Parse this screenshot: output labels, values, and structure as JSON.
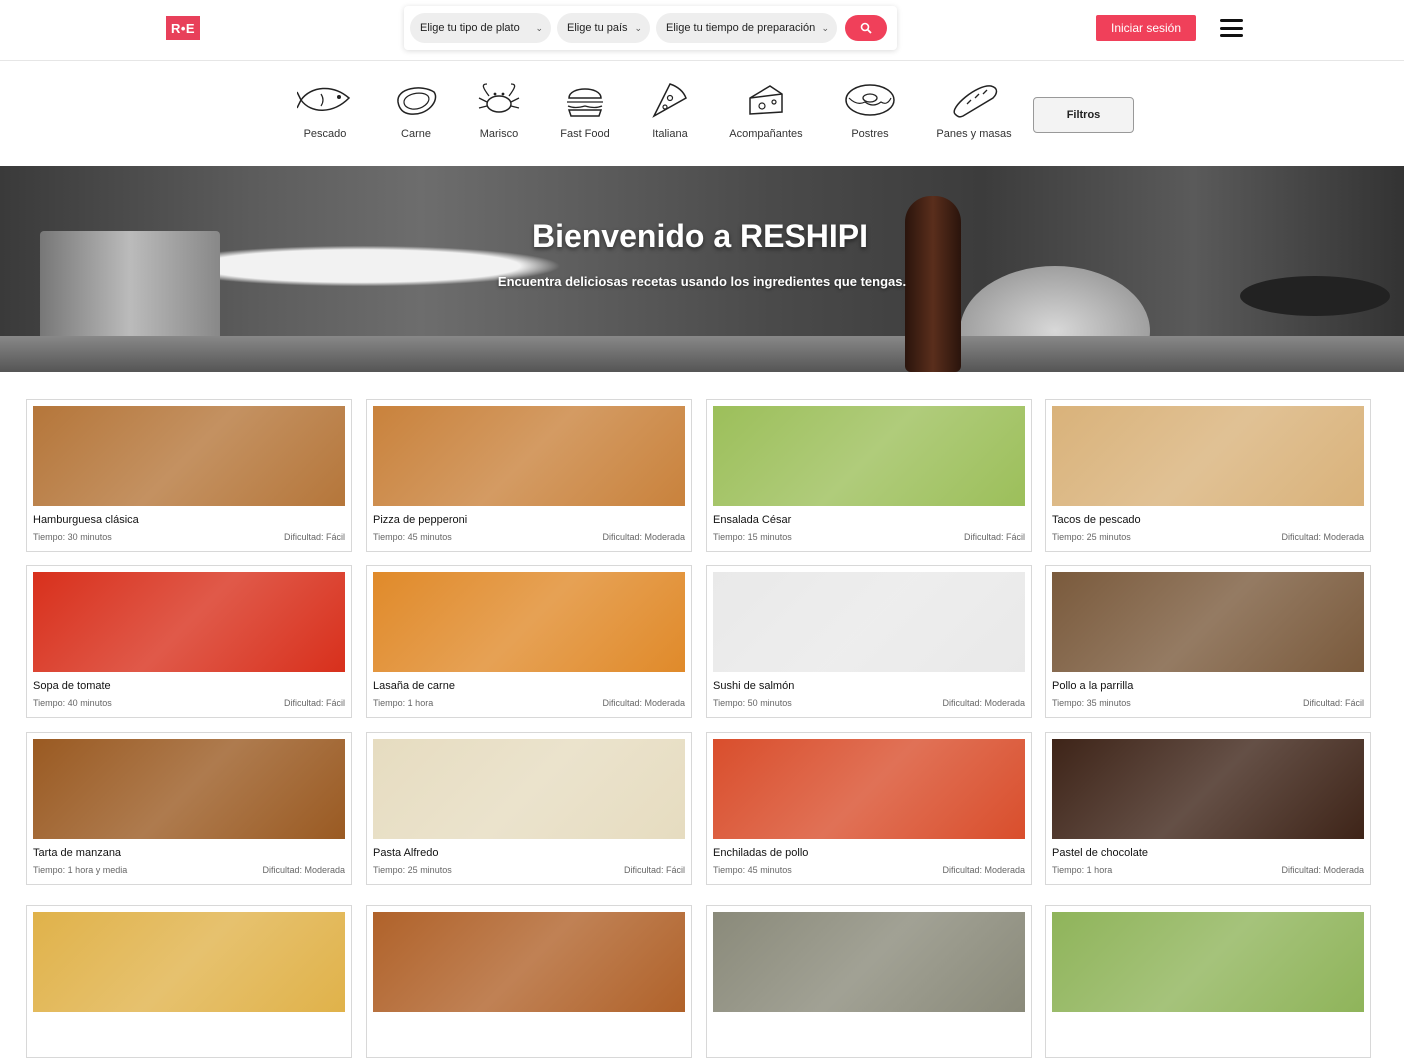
{
  "header": {
    "logo_text": "R•E",
    "filters": [
      {
        "label": "Elige tu tipo de plato"
      },
      {
        "label": "Elige tu país"
      },
      {
        "label": "Elige tu tiempo de preparación"
      }
    ],
    "login_label": "Iniciar sesión",
    "accent_color": "#f0405a"
  },
  "categories": [
    {
      "label": "Pescado",
      "icon": "fish-icon"
    },
    {
      "label": "Carne",
      "icon": "steak-icon"
    },
    {
      "label": "Marisco",
      "icon": "crab-icon"
    },
    {
      "label": "Fast Food",
      "icon": "burger-icon"
    },
    {
      "label": "Italiana",
      "icon": "pizza-slice-icon"
    },
    {
      "label": "Acompañantes",
      "icon": "cheese-icon"
    },
    {
      "label": "Postres",
      "icon": "donut-icon"
    },
    {
      "label": "Panes y masas",
      "icon": "bread-icon"
    }
  ],
  "filters_button": "Filtros",
  "hero": {
    "title": "Bienvenido a RESHIPI",
    "subtitle": "Encuentra deliciosas recetas usando los ingredientes que tengas."
  },
  "recipes": [
    {
      "name": "Hamburguesa clásica",
      "time": "Tiempo: 30 minutos",
      "difficulty": "Dificultad: Fácil",
      "color": "#b5763a"
    },
    {
      "name": "Pizza de pepperoni",
      "time": "Tiempo: 45 minutos",
      "difficulty": "Dificultad: Moderada",
      "color": "#c9823c"
    },
    {
      "name": "Ensalada César",
      "time": "Tiempo: 15 minutos",
      "difficulty": "Dificultad: Fácil",
      "color": "#9cbf5a"
    },
    {
      "name": "Tacos de pescado",
      "time": "Tiempo: 25 minutos",
      "difficulty": "Dificultad: Moderada",
      "color": "#d9b27a"
    },
    {
      "name": "Sopa de tomate",
      "time": "Tiempo: 40 minutos",
      "difficulty": "Dificultad: Fácil",
      "color": "#d8301c"
    },
    {
      "name": "Lasaña de carne",
      "time": "Tiempo: 1 hora",
      "difficulty": "Dificultad: Moderada",
      "color": "#e08a2a"
    },
    {
      "name": "Sushi de salmón",
      "time": "Tiempo: 50 minutos",
      "difficulty": "Dificultad: Moderada",
      "color": "#e9e9e9"
    },
    {
      "name": "Pollo a la parrilla",
      "time": "Tiempo: 35 minutos",
      "difficulty": "Dificultad: Fácil",
      "color": "#7a5a3c"
    },
    {
      "name": "Tarta de manzana",
      "time": "Tiempo: 1 hora y media",
      "difficulty": "Dificultad: Moderada",
      "color": "#9a5a22"
    },
    {
      "name": "Pasta Alfredo",
      "time": "Tiempo: 25 minutos",
      "difficulty": "Dificultad: Fácil",
      "color": "#e6dcc0"
    },
    {
      "name": "Enchiladas de pollo",
      "time": "Tiempo: 45 minutos",
      "difficulty": "Dificultad: Moderada",
      "color": "#d94e2c"
    },
    {
      "name": "Pastel de chocolate",
      "time": "Tiempo: 1 hora",
      "difficulty": "Dificultad: Moderada",
      "color": "#3e2418"
    },
    {
      "name": "",
      "time": "",
      "difficulty": "",
      "color": "#e0b24a"
    },
    {
      "name": "",
      "time": "",
      "difficulty": "",
      "color": "#b0622a"
    },
    {
      "name": "",
      "time": "",
      "difficulty": "",
      "color": "#8a8a7a"
    },
    {
      "name": "",
      "time": "",
      "difficulty": "",
      "color": "#8fb45a"
    }
  ]
}
